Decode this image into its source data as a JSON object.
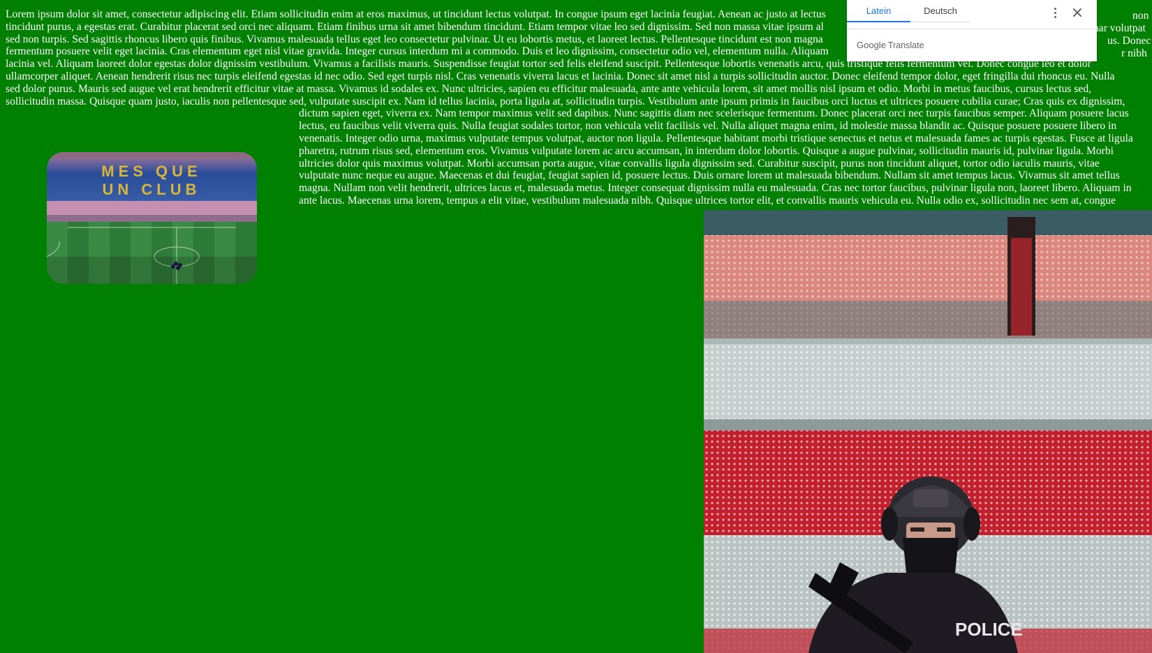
{
  "body_text_lines": [
    "Lorem ipsum dolor sit amet, consectetur adipiscing elit. Etiam sollicitudin enim at eros maximus, ut tincidunt lectus volutpat. In congue ipsum eget lacinia feugiat. Aenean ac justo at lectus",
    "tincidunt purus, a egestas erat. Curabitur placerat sed orci nec aliquam. Etiam finibus urna sit amet bibendum tincidunt. Etiam tempor vitae leo sed dignissim. Sed non massa vitae ipsum al",
    "sed non turpis. Sed sagittis rhoncus libero quis finibus. Vivamus malesuada tellus eget leo consectetur pulvinar. Ut eu lobortis metus, et laoreet lectus. Pellentesque tincidunt est non magna",
    "fermentum posuere velit eget lacinia. Cras elementum eget nisl vitae gravida. Integer cursus interdum mi a commodo. Duis et leo dignissim, consectetur odio vel, elementum nulla. Aliquam",
    "lacinia vel. Aliquam laoreet dolor egestas dolor dignissim vestibulum. Vivamus a facilisis mauris. Suspendisse feugiat tortor sed felis eleifend suscipit. Pellentesque lobortis venenatis arcu, quis tristique felis fermentum vel. Donec congue leo et dolor",
    "ullamcorper aliquet. Aenean hendrerit risus nec turpis eleifend egestas id nec odio. Sed eget turpis nisl. Cras venenatis viverra lacus et lacinia. Donec sit amet nisl a turpis sollicitudin auctor. Donec eleifend tempor dolor, eget fringilla dui rhoncus eu. Nulla",
    "sed dolor purus. Mauris sed augue vel erat hendrerit efficitur vitae at massa. Vivamus id sodales ex. Nunc ultricies, sapien eu efficitur malesuada, ante ante vehicula lorem, sit amet mollis nisl ipsum et odio. Morbi in metus faucibus, cursus lectus sed,",
    "sollicitudin massa. Quisque quam justo, iaculis non pellentesque sed, vulputate suscipit ex. Nam id tellus lacinia, porta ligula at, sollicitudin turpis. Vestibulum ante ipsum primis in faucibus orci luctus et ultrices posuere cubilia curae; Cras quis ex dignissim,"
  ],
  "indented_text_lines": [
    "dictum sapien eget, viverra ex. Nam tempor maximus velit sed dapibus. Nunc sagittis diam nec scelerisque fermentum. Donec placerat orci nec turpis faucibus semper. Aliquam posuere lacus",
    "lectus, eu faucibus velit viverra quis. Nulla feugiat sodales tortor, non vehicula velit facilisis vel. Nulla aliquet magna enim, id molestie massa blandit ac. Quisque posuere posuere libero in",
    "venenatis. Integer odio urna, maximus vulputate tempus volutpat, auctor non ligula. Pellentesque habitant morbi tristique senectus et netus et malesuada fames ac turpis egestas. Fusce at ligula",
    "pharetra, rutrum risus sed, elementum eros. Vivamus vulputate lorem ac arcu accumsan, in interdum dolor lobortis. Quisque a augue pulvinar, sollicitudin mauris id, pulvinar ligula. Morbi",
    "ultricies dolor quis maximus volutpat. Morbi accumsan porta augue, vitae convallis ligula dignissim sed. Curabitur suscipit, purus non tincidunt aliquet, tortor odio iaculis mauris, vitae",
    "vulputate nunc neque eu augue. Maecenas et dui feugiat, feugiat sapien id, posuere lectus. Duis ornare lorem ut malesuada bibendum. Nullam sit amet tempus lacus. Vivamus sit amet tellus",
    "magna. Nullam non velit hendrerit, ultrices lacus et, malesuada metus. Integer consequat dignissim nulla eu malesuada. Cras nec tortor faucibus, pulvinar ligula non, laoreet libero. Aliquam in",
    "ante lacus. Maecenas urna lorem, tempus a elit vitae, vestibulum malesuada nibh. Quisque ultrices tortor elit, et convallis mauris vehicula eu. Nulla odio ex, sollicitudin nec sem at, congue"
  ],
  "right_edge_fragments": [
    "non",
    "nar volutpat",
    "us. Donec",
    "r nibh"
  ],
  "stadium_photo": {
    "seat_lettering": [
      "MES QUE",
      "UN CLUB"
    ]
  },
  "translate_popup": {
    "tabs": [
      {
        "label": "Latein",
        "active": true
      },
      {
        "label": "Deutsch",
        "active": false
      }
    ],
    "brand_google": "Google",
    "brand_translate": "Translate",
    "accent_color": "#1a73e8"
  },
  "police_photo": {
    "vest_text": "POLICE"
  },
  "colors": {
    "page_background": "#008000",
    "text": "#ffffff"
  }
}
